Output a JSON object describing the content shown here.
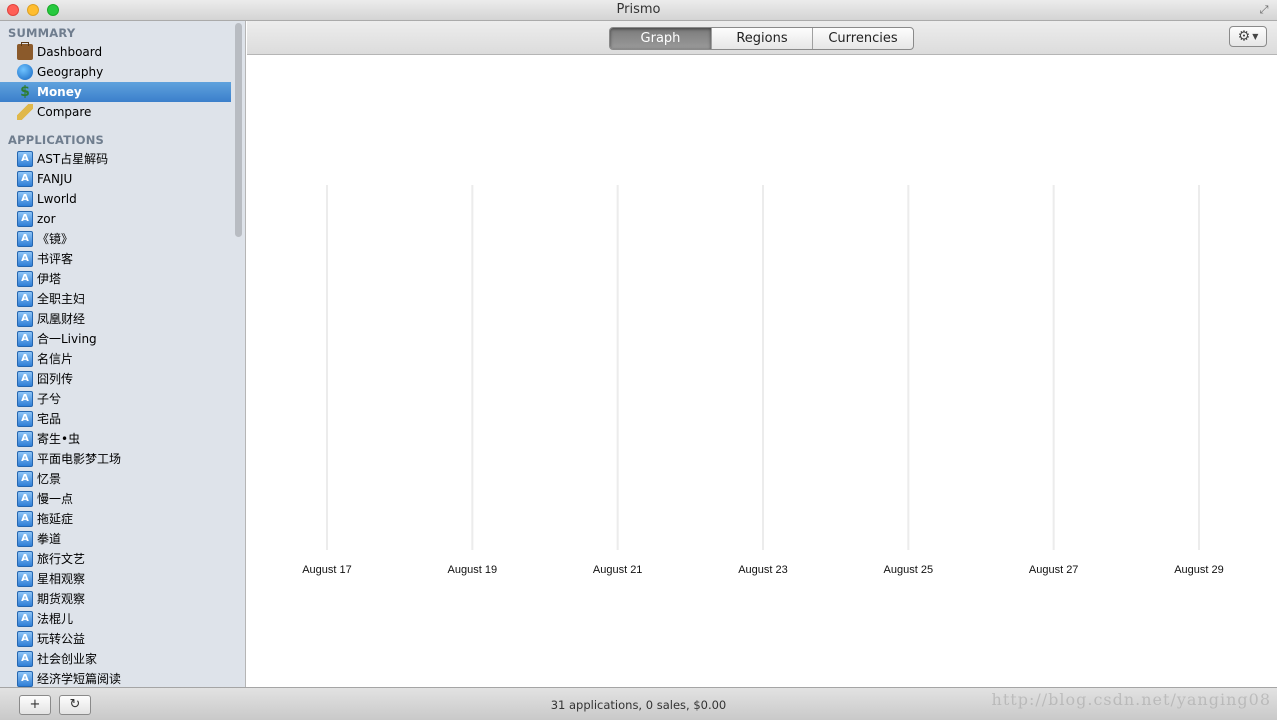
{
  "window": {
    "title": "Prismo"
  },
  "sidebar": {
    "summary_header": "SUMMARY",
    "summary_items": [
      {
        "label": "Dashboard",
        "icon": "briefcase-icon"
      },
      {
        "label": "Geography",
        "icon": "globe-icon"
      },
      {
        "label": "Money",
        "icon": "money-icon",
        "selected": true
      },
      {
        "label": "Compare",
        "icon": "ruler-icon"
      }
    ],
    "applications_header": "APPLICATIONS",
    "applications": [
      "AST占星解码",
      "FANJU",
      "Lworld",
      "zor",
      "《镜》",
      "书评客",
      "伊塔",
      "全职主妇",
      "凤凰财经",
      "合一Living",
      "名信片",
      "囧列传",
      "子兮",
      "宅品",
      "寄生•虫",
      "平面电影梦工场",
      "忆景",
      "慢一点",
      "拖延症",
      "拳道",
      "旅行文艺",
      "星相观察",
      "期货观察",
      "法棍儿",
      "玩转公益",
      "社会创业家",
      "经济学短篇阅读"
    ]
  },
  "toolbar": {
    "tabs": [
      {
        "label": "Graph",
        "active": true
      },
      {
        "label": "Regions"
      },
      {
        "label": "Currencies"
      }
    ],
    "gear_icon": "gear-icon"
  },
  "chart_data": {
    "type": "bar",
    "categories": [
      "August 17",
      "August 19",
      "August 21",
      "August 23",
      "August 25",
      "August 27",
      "August 29"
    ],
    "values": [
      0,
      0,
      0,
      0,
      0,
      0,
      0
    ],
    "title": "",
    "xlabel": "",
    "ylabel": "",
    "grid": true
  },
  "status": {
    "summary": "31 applications, 0 sales, $0.00",
    "add_label": "+",
    "refresh_label": "↻",
    "watermark": "http://blog.csdn.net/yanging08"
  }
}
